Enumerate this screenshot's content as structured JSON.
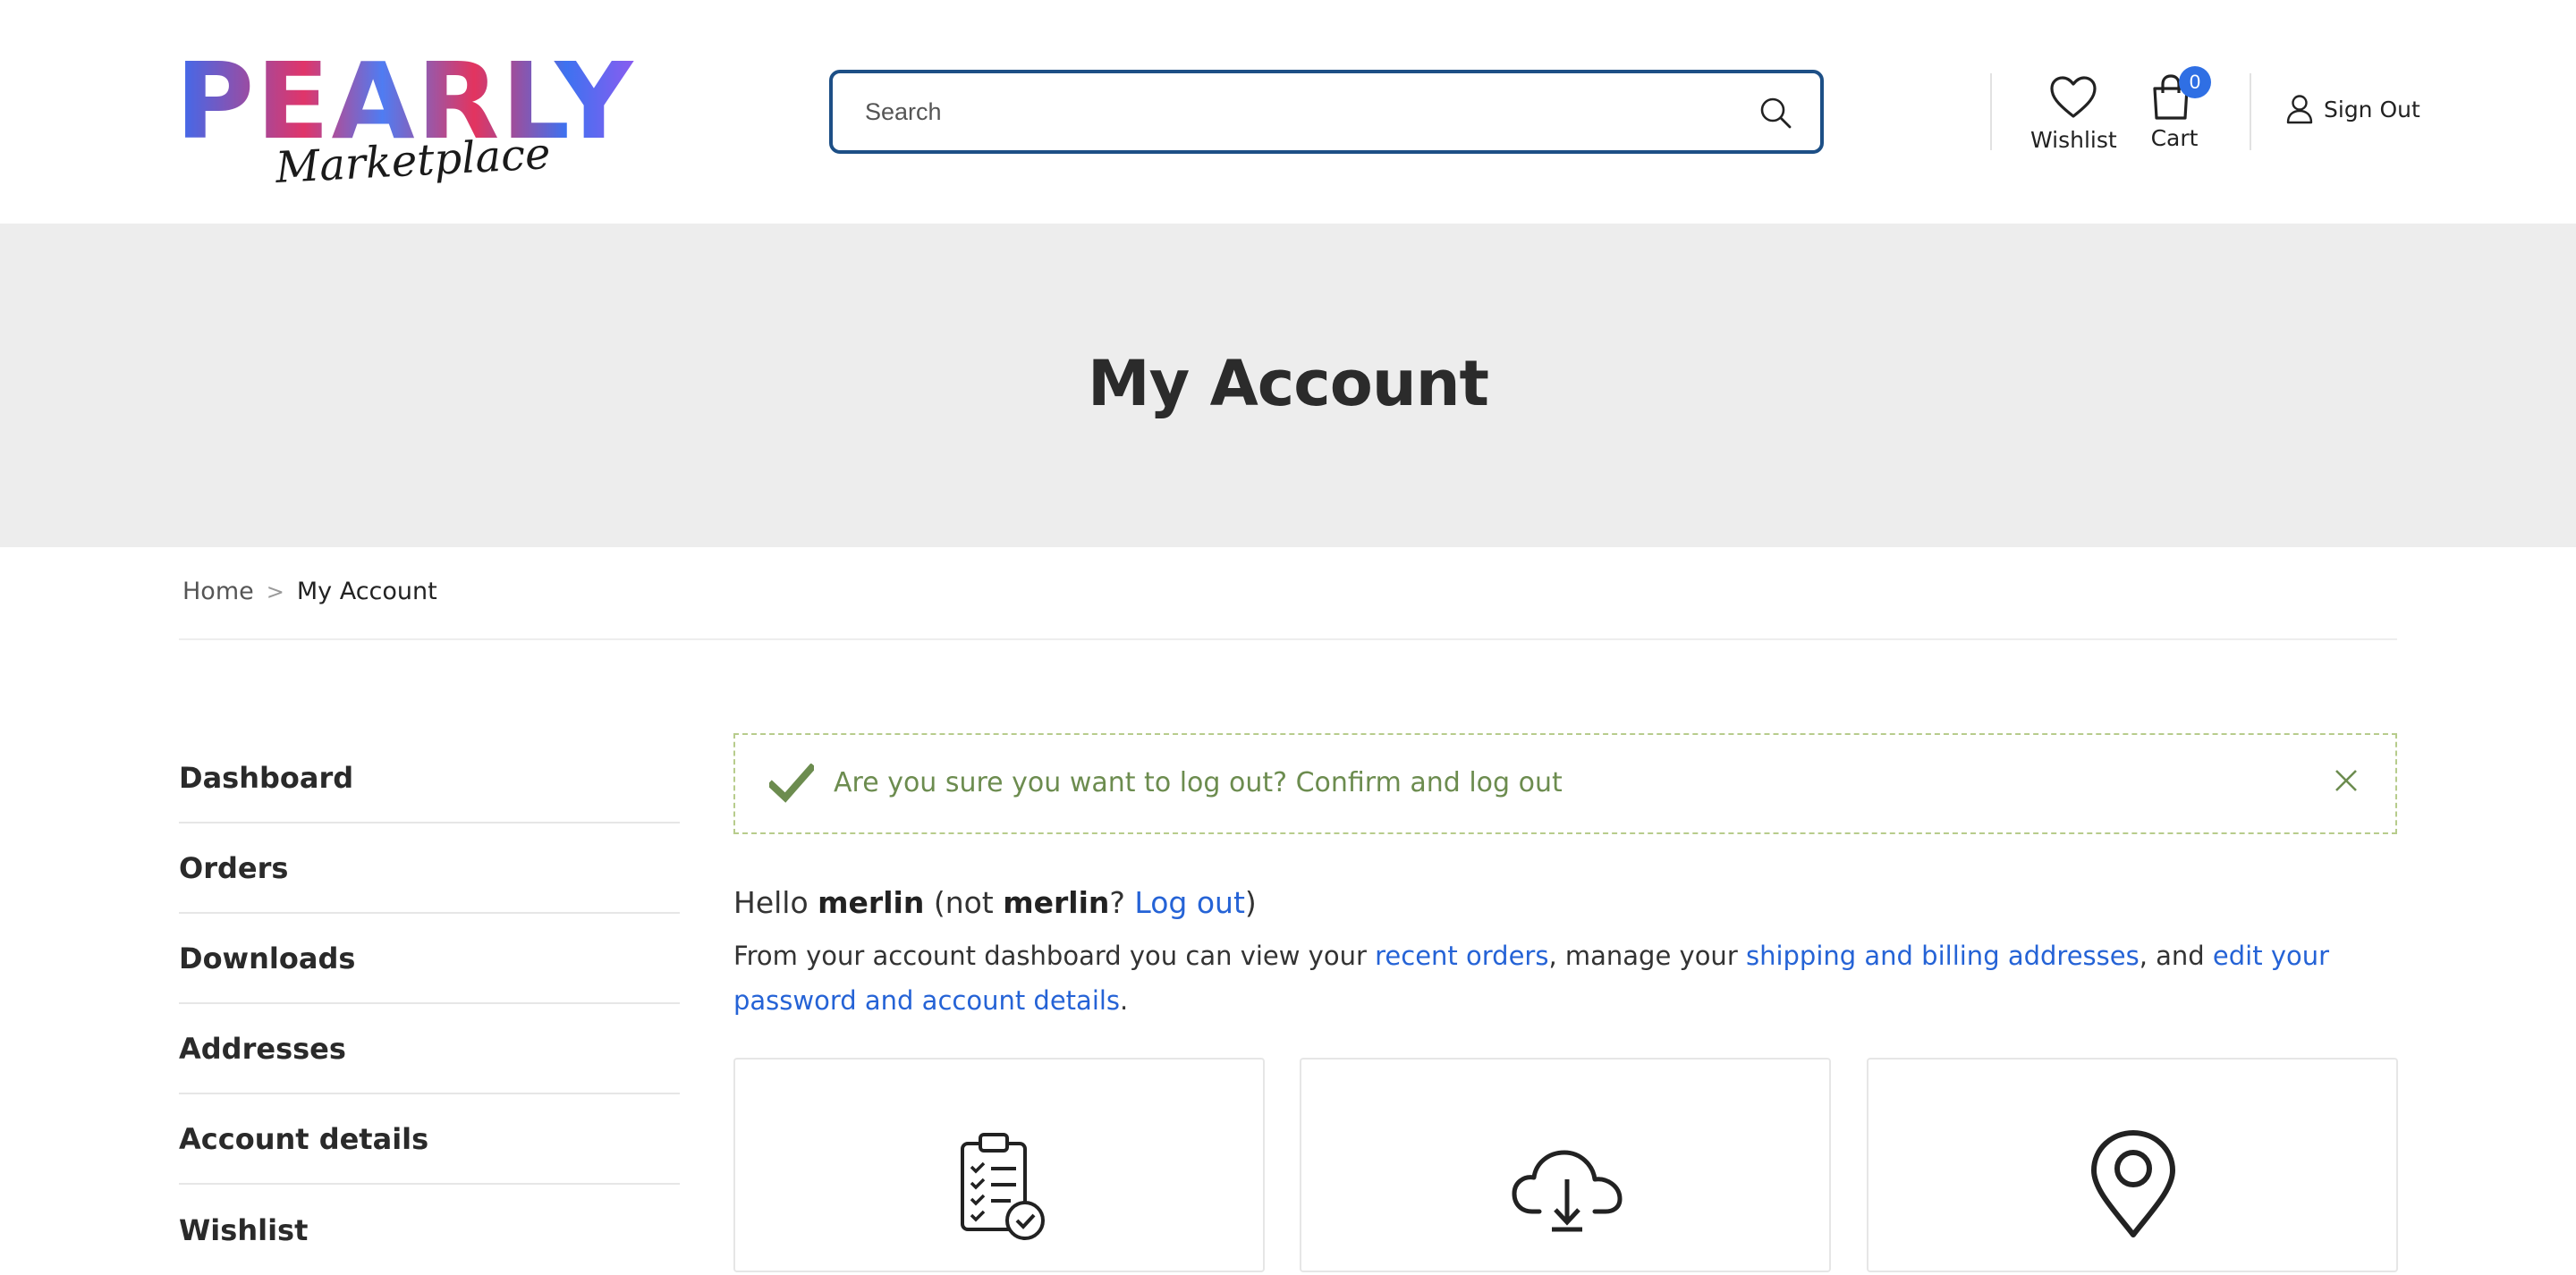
{
  "header": {
    "logo": {
      "word": "PEARLY",
      "sub": "Marketplace"
    },
    "search": {
      "placeholder": "Search"
    },
    "wishlist_label": "Wishlist",
    "cart_label": "Cart",
    "cart_count": "0",
    "signout_label": "Sign Out"
  },
  "hero": {
    "title": "My Account"
  },
  "breadcrumb": {
    "home": "Home",
    "separator": ">",
    "current": "My Account"
  },
  "sidebar": {
    "items": [
      {
        "label": "Dashboard"
      },
      {
        "label": "Orders"
      },
      {
        "label": "Downloads"
      },
      {
        "label": "Addresses"
      },
      {
        "label": "Account details"
      },
      {
        "label": "Wishlist"
      }
    ]
  },
  "notice": {
    "message": "Are you sure you want to log out? Confirm and log out"
  },
  "greeting": {
    "hello": "Hello",
    "username": "merlin",
    "not_open": " (not ",
    "username2": "merlin",
    "q": "? ",
    "logout": "Log out",
    "close_paren": ")"
  },
  "intro": {
    "part1": "From your account dashboard you can view your ",
    "link1": "recent orders",
    "part2": ", manage your ",
    "link2": "shipping and billing addresses",
    "part3": ", and ",
    "link3": "edit your password and account details",
    "part4": "."
  },
  "cards": [
    {
      "icon": "clipboard-check-icon"
    },
    {
      "icon": "cloud-download-icon"
    },
    {
      "icon": "map-pin-icon"
    }
  ],
  "colors": {
    "accent": "#2563d6",
    "search_border": "#1d4f86",
    "badge": "#2f6fe4",
    "notice_text": "#6c8c4f",
    "notice_border": "#b7cc8c",
    "hero_bg": "#ededed"
  }
}
